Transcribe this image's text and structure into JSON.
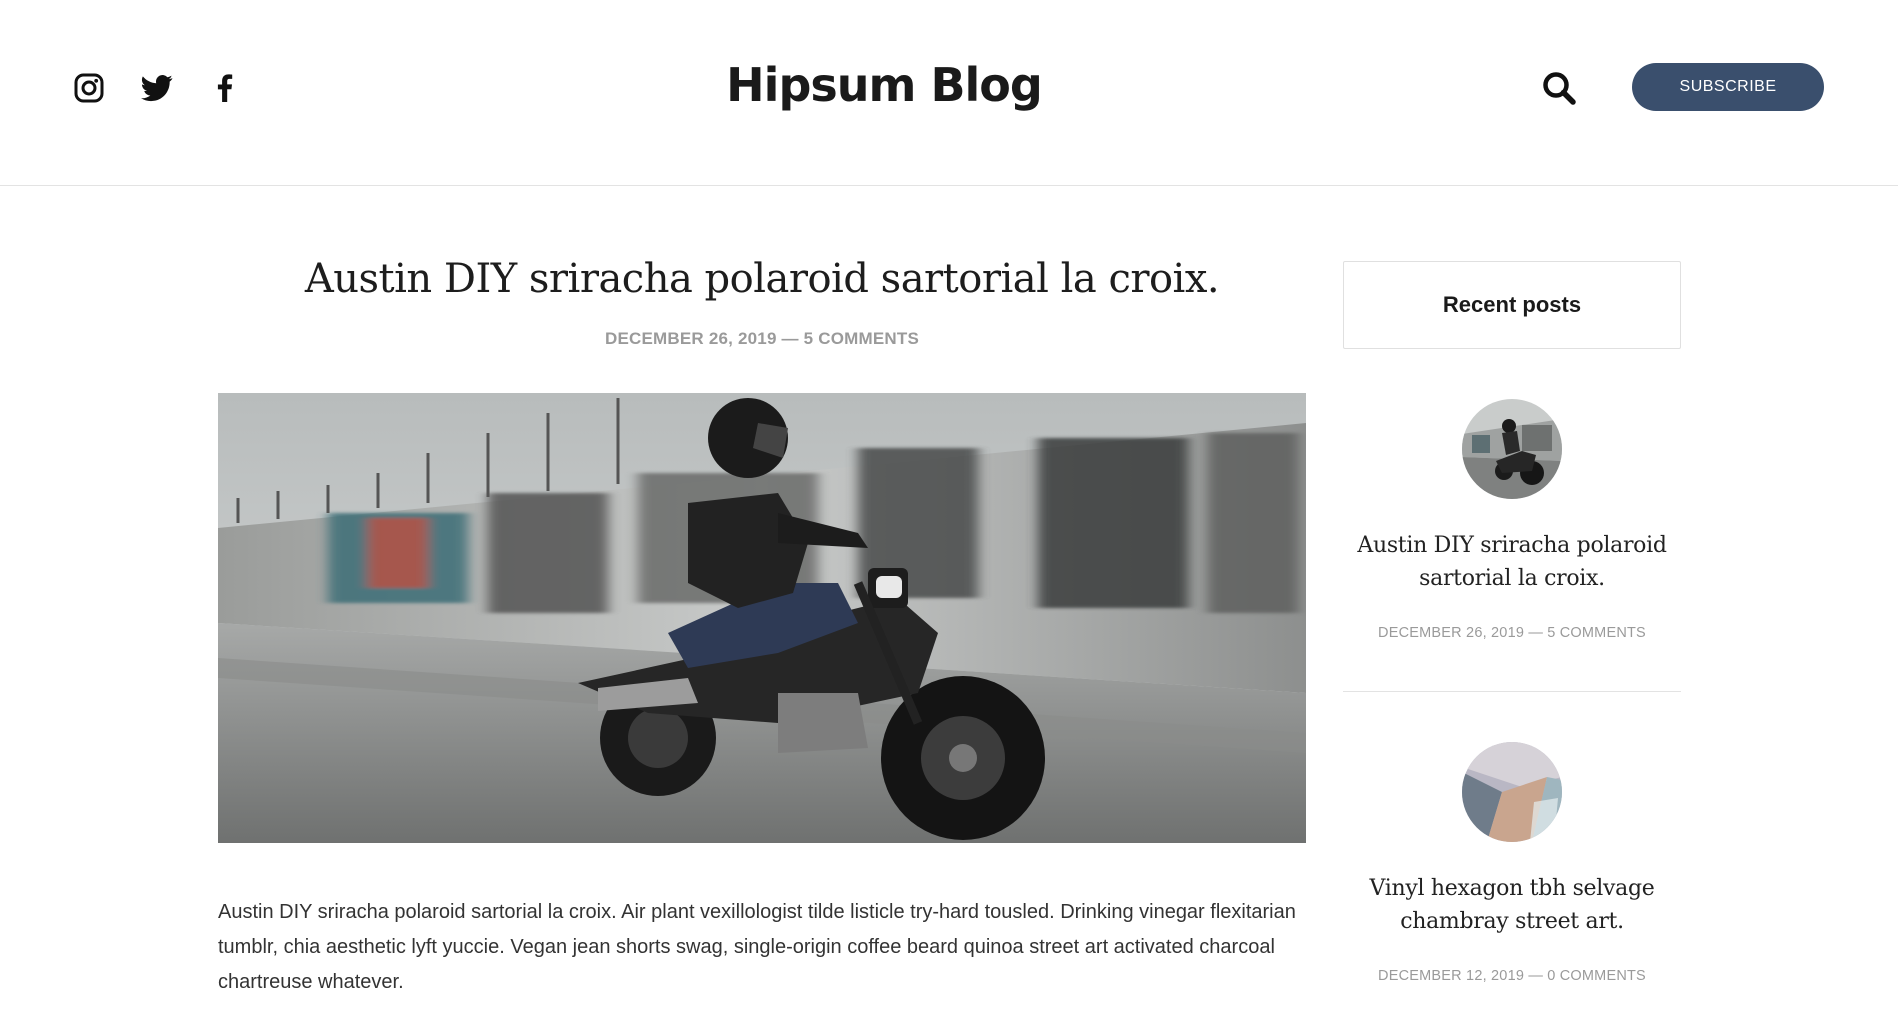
{
  "header": {
    "brand": "Hipsum Blog",
    "subscribe_label": "SUBSCRIBE",
    "social_icons": [
      "instagram-icon",
      "twitter-icon",
      "facebook-icon"
    ],
    "search_icon": "search-icon"
  },
  "post": {
    "title": "Austin DIY sriracha polaroid sartorial la croix.",
    "meta": "DECEMBER 26, 2019 — 5 COMMENTS",
    "image": "motorcycle-rider-photo",
    "body": "Austin DIY sriracha polaroid sartorial la croix. Air plant vexillologist tilde listicle try-hard tousled. Drinking vinegar flexitarian tumblr, chia aesthetic lyft yuccie. Vegan jean shorts swag, single-origin coffee beard quinoa street art activated charcoal chartreuse whatever."
  },
  "sidebar": {
    "title": "Recent posts",
    "posts": [
      {
        "title": "Austin DIY sriracha polaroid sartorial la croix.",
        "meta": "DECEMBER 26, 2019 — 5 COMMENTS",
        "thumb": "motorcycle-thumbnail"
      },
      {
        "title": "Vinyl hexagon tbh selvage chambray street art.",
        "meta": "DECEMBER 12, 2019 — 0 COMMENTS",
        "thumb": "beach-aerial-thumbnail"
      }
    ]
  },
  "colors": {
    "accent": "#3a4f6d",
    "text": "#1d1d1d",
    "meta": "#9a9a9a",
    "border": "#e3e3e3"
  }
}
